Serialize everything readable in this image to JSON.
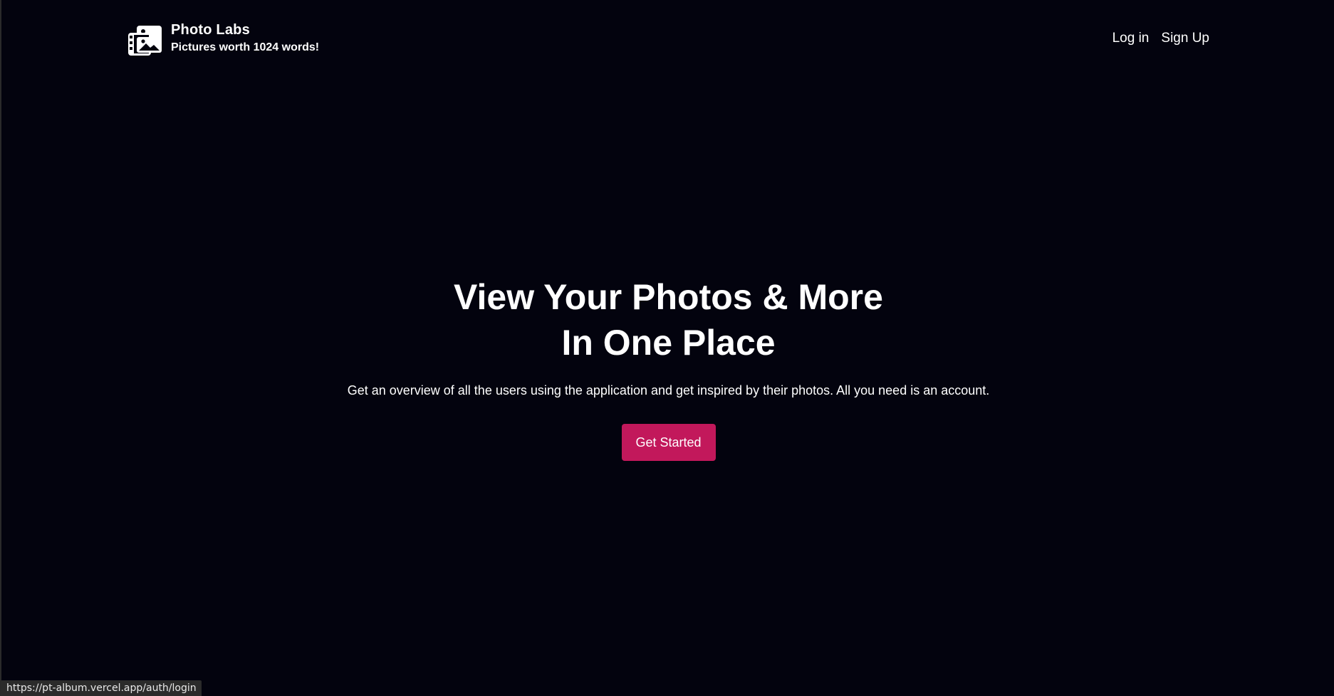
{
  "brand": {
    "icon": "photo-album-icon",
    "title": "Photo Labs",
    "subtitle": "Pictures worth 1024 words!"
  },
  "nav": {
    "login_label": "Log in",
    "signup_label": "Sign Up"
  },
  "hero": {
    "title_line1": "View Your Photos & More",
    "title_line2": "In One Place",
    "description": "Get an overview of all the users using the application and get inspired by their photos. All you need is an account.",
    "cta_label": "Get Started"
  },
  "status_bar": {
    "url": "https://pt-album.vercel.app/auth/login"
  },
  "colors": {
    "background": "#03030e",
    "accent": "#c2185b",
    "text": "#ffffff"
  }
}
